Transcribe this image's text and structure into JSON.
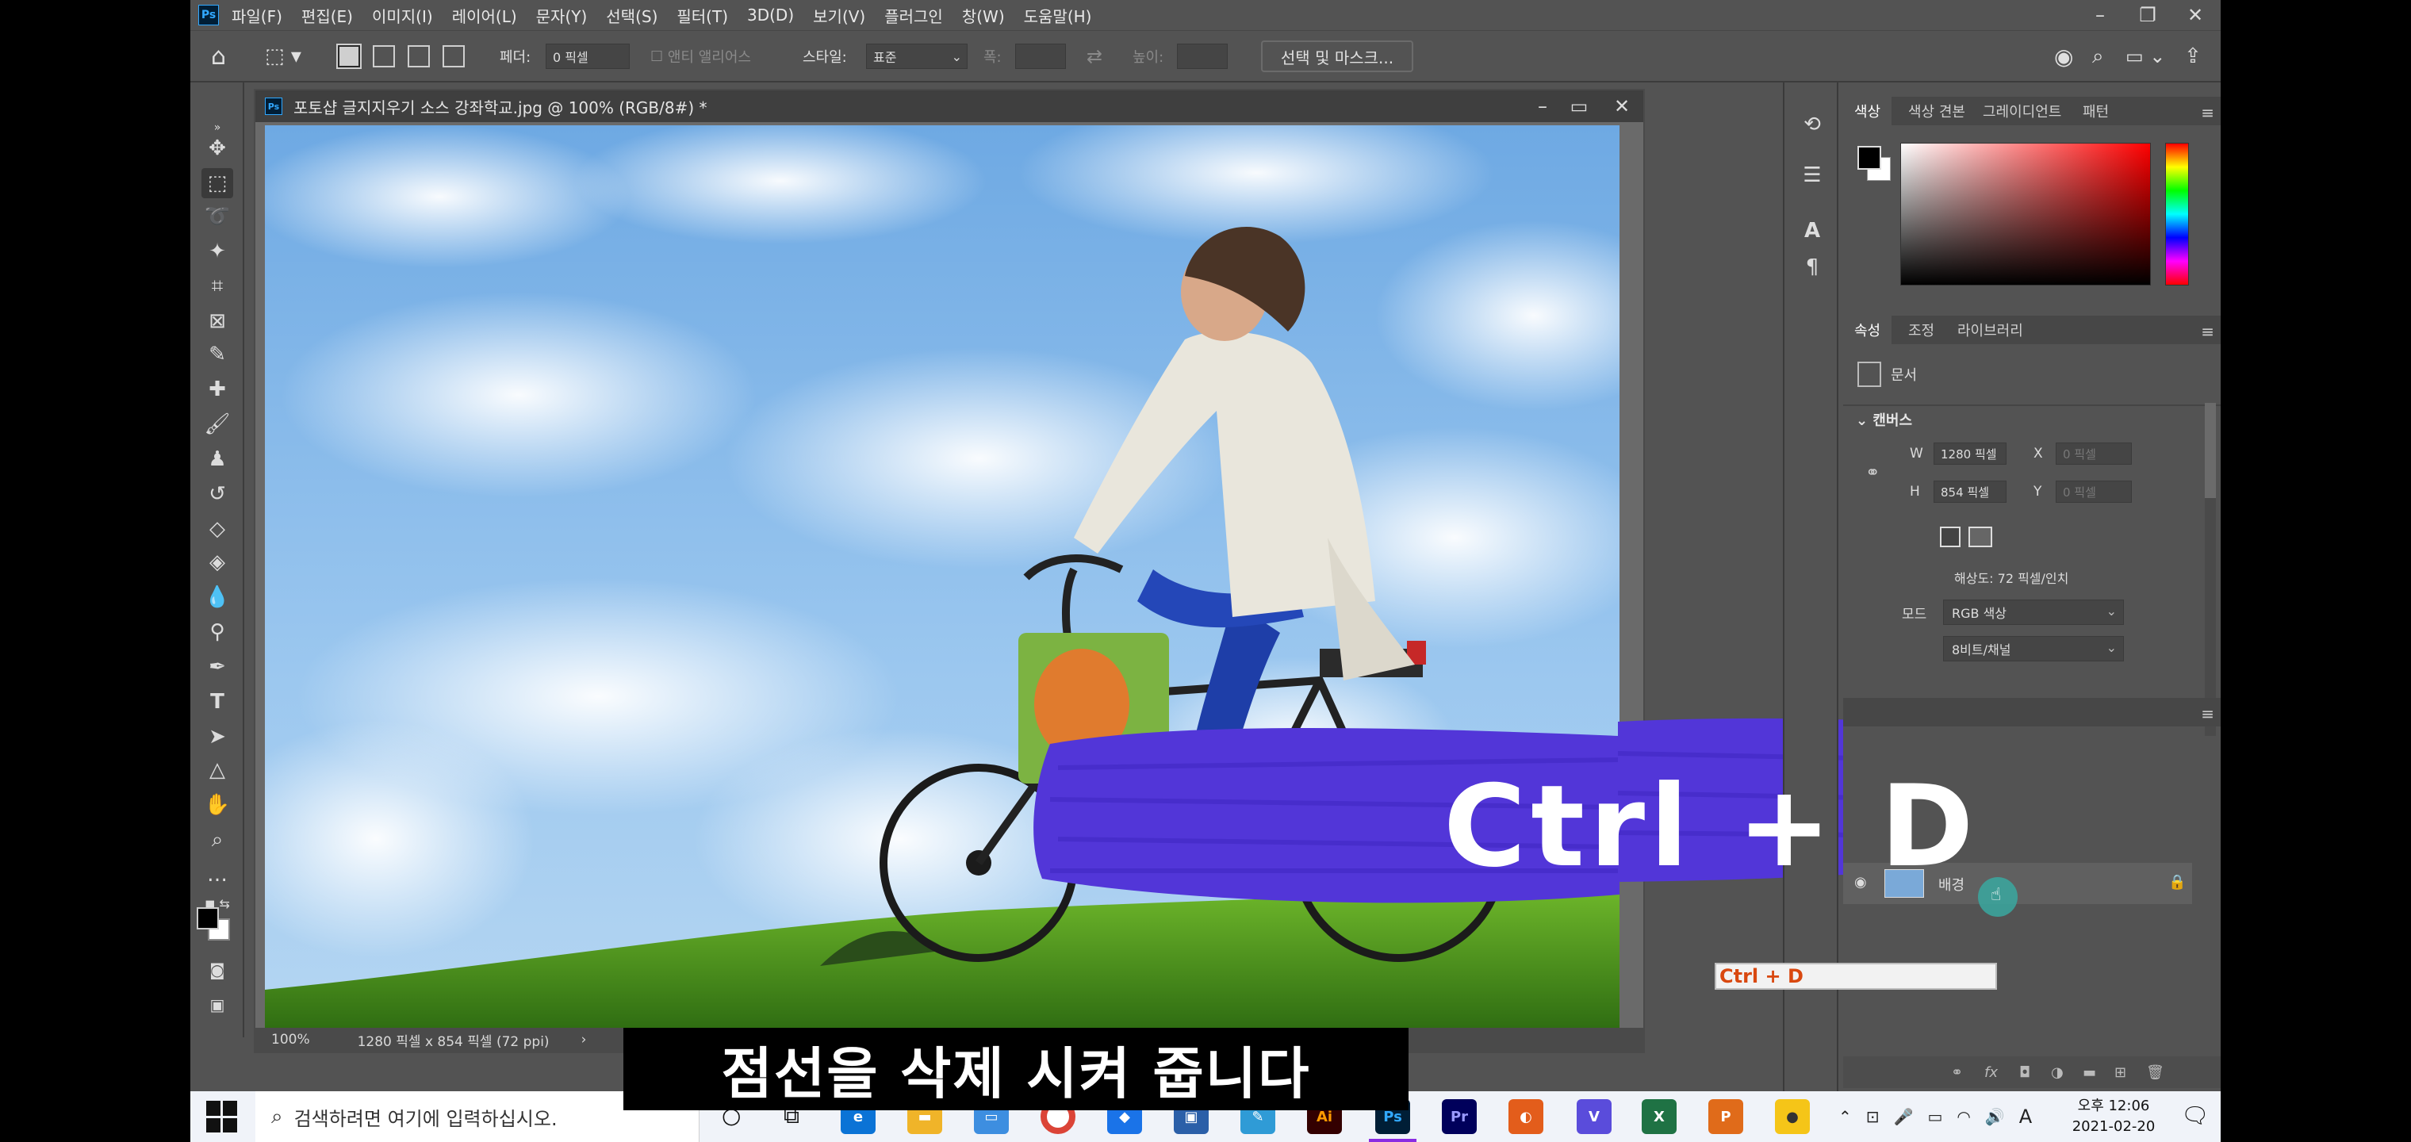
{
  "app": {
    "menu": [
      "파일(F)",
      "편집(E)",
      "이미지(I)",
      "레이어(L)",
      "문자(Y)",
      "선택(S)",
      "필터(T)",
      "3D(D)",
      "보기(V)",
      "플러그인",
      "창(W)",
      "도움말(H)"
    ],
    "logo": "Ps"
  },
  "options": {
    "feather_label": "페더:",
    "feather_value": "0 픽셀",
    "antialias_label": "앤티 앨리어스",
    "style_label": "스타일:",
    "style_value": "표준",
    "width_label": "폭:",
    "height_label": "높이:",
    "select_mask_button": "선택 및 마스크..."
  },
  "document": {
    "title": "포토샵 글지지우기 소스 강좌학교.jpg @ 100% (RGB/8#) *",
    "zoom": "100%",
    "status": "1280 픽셀 x 854 픽셀 (72 ppi)",
    "status_arrow": "›"
  },
  "color_panel": {
    "tabs": [
      "색상",
      "색상 견본",
      "그레이디언트",
      "패턴"
    ]
  },
  "properties_panel": {
    "tabs": [
      "속성",
      "조정",
      "라이브러리"
    ],
    "doc_label": "문서",
    "section": "캔버스",
    "w_label": "W",
    "w_value": "1280 픽셀",
    "h_label": "H",
    "h_value": "854 픽셀",
    "x_label": "X",
    "x_value": "0 픽셀",
    "y_label": "Y",
    "y_value": "0 픽셀",
    "resolution": "해상도: 72 픽셀/인치",
    "mode_label": "모드",
    "mode_value": "RGB 색상",
    "depth_value": "8비트/채널"
  },
  "layers_panel": {
    "layer_name": "배경"
  },
  "overlay": {
    "brush_text": "Ctrl + D",
    "shortcut_label": "Ctrl + D",
    "subtitle": "점선을 삭제 시켜 줍니다",
    "brush_color": "#5236d8"
  },
  "taskbar": {
    "search_placeholder": "검색하려면 여기에 입력하십시오.",
    "ime": "A",
    "time": "오후 12:06",
    "date": "2021-02-20",
    "apps": [
      {
        "name": "ai",
        "label": "Ai",
        "color": "#330000",
        "fg": "#ff9a00"
      },
      {
        "name": "ps",
        "label": "Ps",
        "color": "#001e36",
        "fg": "#31a8ff"
      },
      {
        "name": "pr",
        "label": "Pr",
        "color": "#00005b",
        "fg": "#9999ff"
      }
    ]
  }
}
